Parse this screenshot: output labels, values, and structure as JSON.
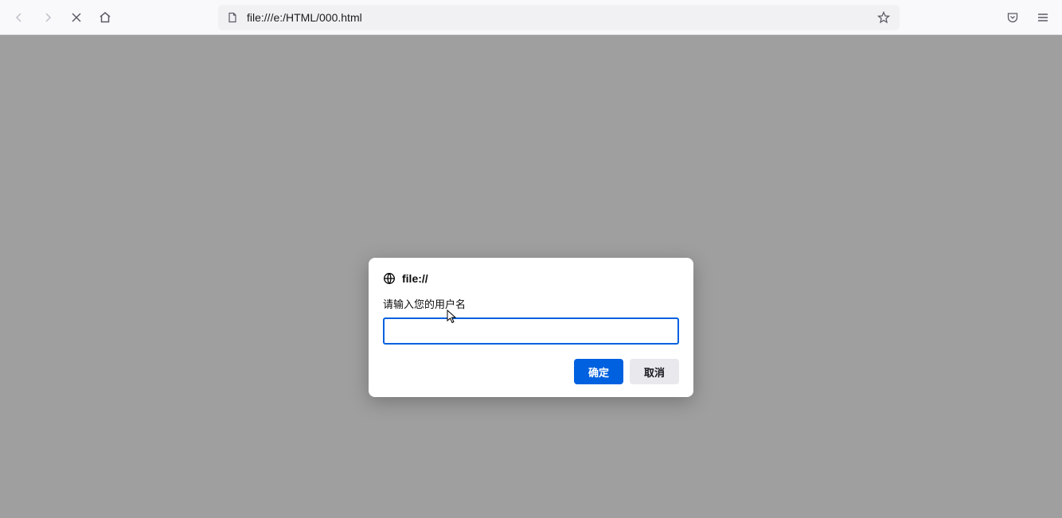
{
  "browser": {
    "url": "file:///e:/HTML/000.html"
  },
  "dialog": {
    "origin": "file://",
    "message": "请输入您的用户名",
    "input_value": "",
    "input_placeholder": "",
    "ok_label": "确定",
    "cancel_label": "取消"
  }
}
